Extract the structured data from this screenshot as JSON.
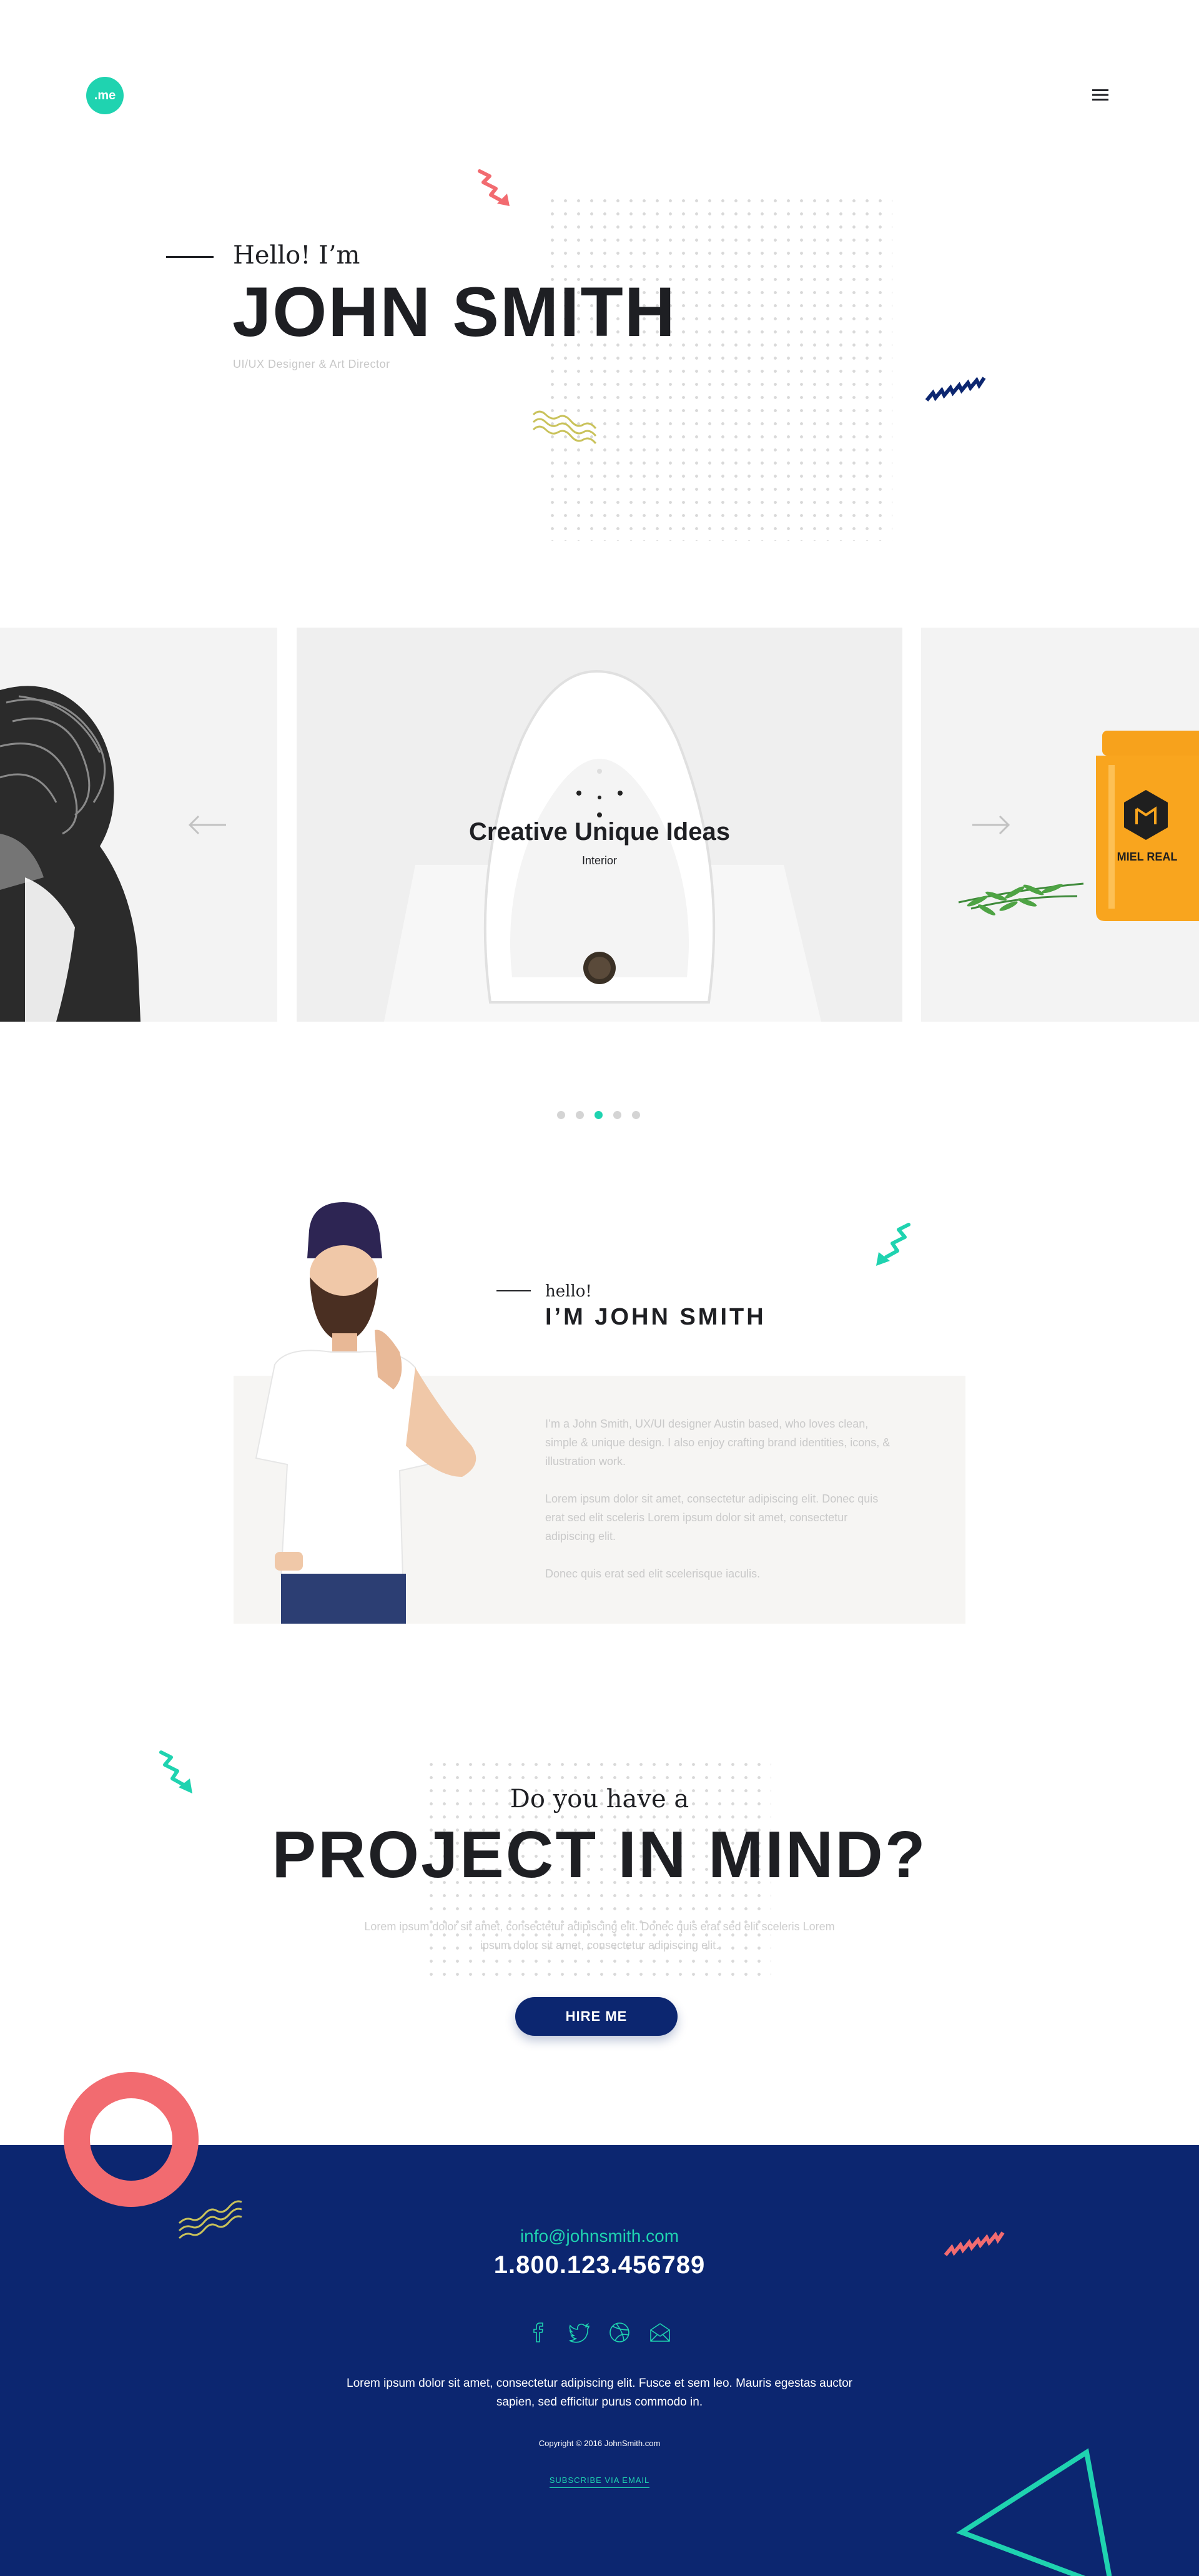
{
  "header": {
    "logo_text": ".me",
    "menu_icon": "hamburger-icon"
  },
  "hero": {
    "hello": "Hello! I’m",
    "name": "JOHN SMITH",
    "role": "UI/UX Designer & Art Director"
  },
  "slider": {
    "title": "Creative Unique Ideas",
    "category": "Interior",
    "jar_label": "MIEL REAL",
    "dots": 5,
    "active_dot": 3
  },
  "about": {
    "hello": "hello!",
    "name": "I’M JOHN SMITH",
    "paragraphs": [
      "I’m a John Smith, UX/UI designer Austin based, who loves clean, simple & unique design. I also enjoy crafting brand identities, icons, & illustration work.",
      "Lorem ipsum dolor sit amet, consectetur adipiscing elit. Donec quis erat sed elit sceleris Lorem ipsum dolor sit amet, consectetur adipiscing elit.",
      "Donec quis erat sed elit scelerisque iaculis."
    ]
  },
  "project": {
    "question": "Do you have a",
    "title": "PROJECT IN MIND?",
    "text": "Lorem ipsum dolor sit amet, consectetur adipiscing elit. Donec quis erat sed elit sceleris Lorem ipsum dolor sit amet, consectetur adipiscing elit.",
    "button": "HIRE ME"
  },
  "footer": {
    "email": "info@johnsmith.com",
    "phone": "1.800.123.456789",
    "social_icons": [
      "facebook-icon",
      "twitter-icon",
      "dribbble-icon",
      "mail-icon"
    ],
    "text": "Lorem ipsum dolor sit amet, consectetur adipiscing elit. Fusce et sem leo. Mauris egestas auctor sapien, sed efficitur purus commodo in.",
    "copyright": "Copyright © 2016 JohnSmith.com",
    "subscribe": "SUBSCRIBE VIA EMAIL"
  },
  "colors": {
    "accent": "#1fd3b0",
    "navy": "#0c2670",
    "coral": "#f26b70",
    "olive": "#c9c25a",
    "dark": "#1e1f23"
  }
}
